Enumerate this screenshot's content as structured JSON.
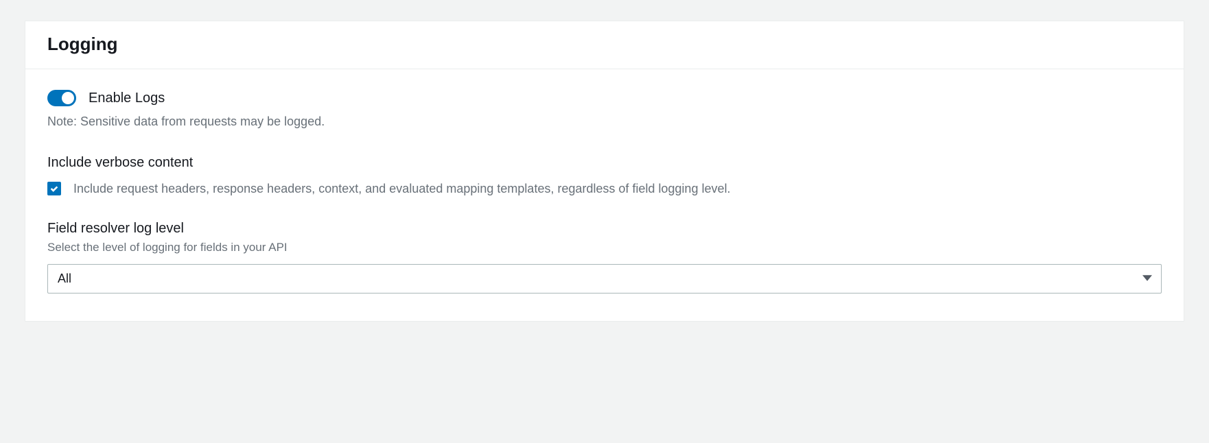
{
  "panel": {
    "title": "Logging"
  },
  "enableLogs": {
    "label": "Enable Logs",
    "note": "Note: Sensitive data from requests may be logged."
  },
  "verbose": {
    "title": "Include verbose content",
    "description": "Include request headers, response headers, context, and evaluated mapping templates, regardless of field logging level."
  },
  "logLevel": {
    "title": "Field resolver log level",
    "hint": "Select the level of logging for fields in your API",
    "selected": "All"
  },
  "colors": {
    "accent": "#0073bb"
  }
}
